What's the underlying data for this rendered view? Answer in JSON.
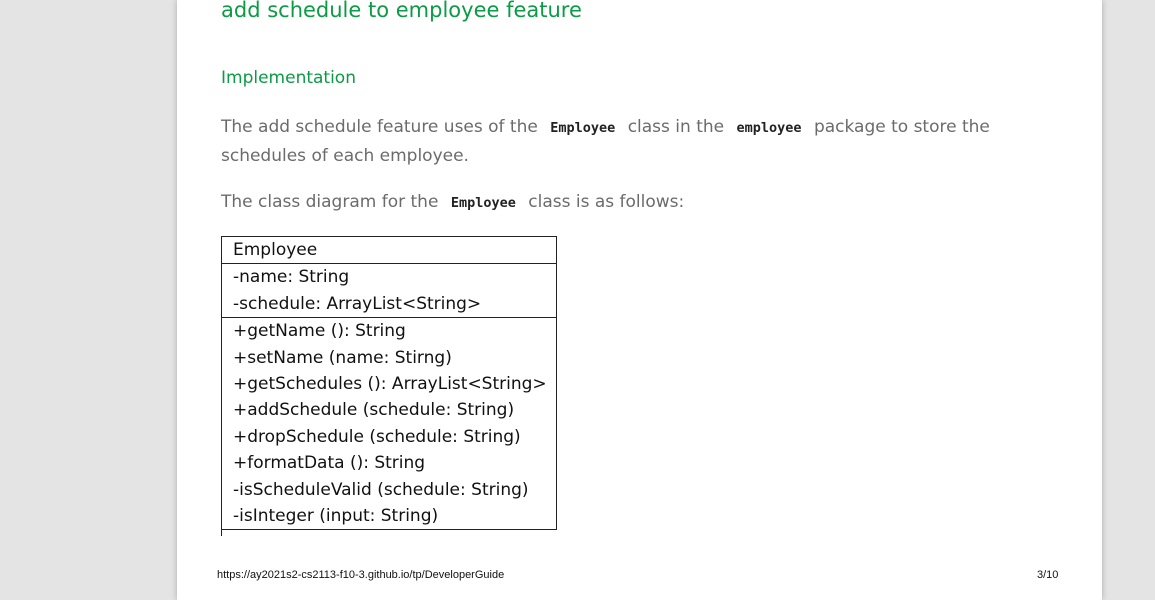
{
  "section": {
    "heading": "add schedule to employee feature",
    "subheading": "Implementation",
    "paragraph1": {
      "part1": "The add schedule feature uses of the",
      "code1": "Employee",
      "part2": "class in the",
      "code2": "employee",
      "part3": "package to store the schedules of each employee."
    },
    "paragraph2": {
      "part1": "The class diagram for the",
      "code1": "Employee",
      "part2": "class is as follows:"
    }
  },
  "class_diagram": {
    "class_name": "Employee",
    "attributes": [
      "-name: String",
      "-schedule: ArrayList<String>"
    ],
    "methods": [
      "+getName (): String",
      "+setName (name: Stirng)",
      "+getSchedules (): ArrayList<String>",
      "+addSchedule (schedule: String)",
      "+dropSchedule (schedule: String)",
      "+formatData (): String",
      "-isScheduleValid (schedule: String)",
      "-isInteger (input: String)"
    ]
  },
  "footer": {
    "url": "https://ay2021s2-cs2113-f10-3.github.io/tp/DeveloperGuide",
    "page": "3/10"
  }
}
